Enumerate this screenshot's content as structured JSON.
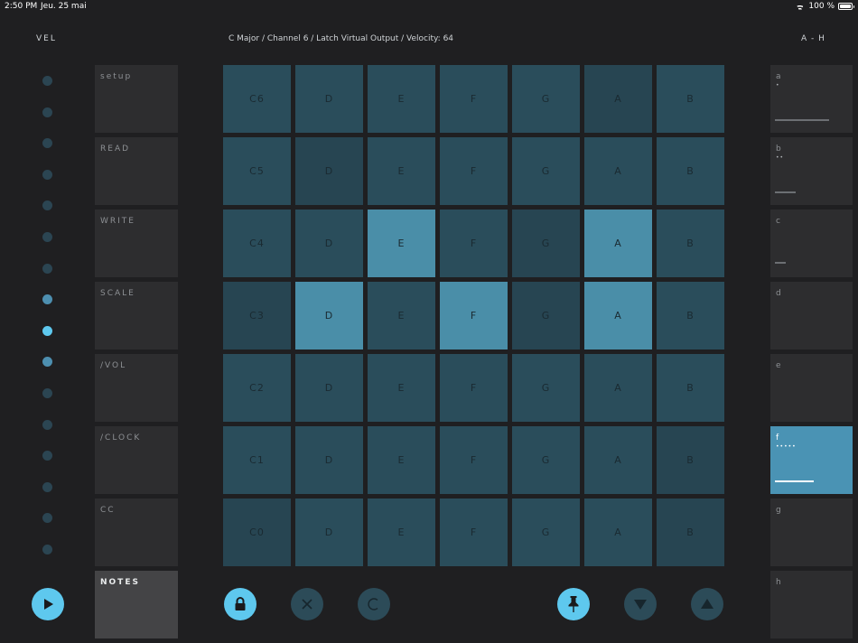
{
  "status": {
    "time": "2:50 PM",
    "date": "Jeu. 25 mai",
    "battery": "100 %"
  },
  "header": {
    "vel_title": "VEL",
    "info": "C Major / Channel 6 / Latch Virtual Output / Velocity: 64",
    "slots_title": "A - H"
  },
  "velocity": {
    "levels": 16,
    "active_level": 8,
    "lit_levels": [
      7,
      8,
      9
    ]
  },
  "menu": [
    {
      "label": "setup",
      "active": false
    },
    {
      "label": "READ",
      "active": false
    },
    {
      "label": "WRITE",
      "active": false
    },
    {
      "label": "SCALE",
      "active": false
    },
    {
      "label": "/VOL",
      "active": false
    },
    {
      "label": "/CLOCK",
      "active": false
    },
    {
      "label": "CC",
      "active": false
    },
    {
      "label": "NOTES",
      "active": true
    }
  ],
  "grid": {
    "rows": [
      {
        "notes": [
          "C6",
          "D",
          "E",
          "F",
          "G",
          "A",
          "B"
        ],
        "lit": [
          false,
          false,
          false,
          false,
          false,
          false,
          false
        ]
      },
      {
        "notes": [
          "C5",
          "D",
          "E",
          "F",
          "G",
          "A",
          "B"
        ],
        "lit": [
          false,
          false,
          false,
          false,
          false,
          false,
          false
        ]
      },
      {
        "notes": [
          "C4",
          "D",
          "E",
          "F",
          "G",
          "A",
          "B"
        ],
        "lit": [
          false,
          false,
          true,
          false,
          false,
          true,
          false
        ]
      },
      {
        "notes": [
          "C3",
          "D",
          "E",
          "F",
          "G",
          "A",
          "B"
        ],
        "lit": [
          false,
          true,
          false,
          true,
          false,
          true,
          false
        ]
      },
      {
        "notes": [
          "C2",
          "D",
          "E",
          "F",
          "G",
          "A",
          "B"
        ],
        "lit": [
          false,
          false,
          false,
          false,
          false,
          false,
          false
        ]
      },
      {
        "notes": [
          "C1",
          "D",
          "E",
          "F",
          "G",
          "A",
          "B"
        ],
        "lit": [
          false,
          false,
          false,
          false,
          false,
          false,
          false
        ]
      },
      {
        "notes": [
          "C0",
          "D",
          "E",
          "F",
          "G",
          "A",
          "B"
        ],
        "lit": [
          false,
          false,
          false,
          false,
          false,
          false,
          false
        ]
      }
    ]
  },
  "slots": [
    {
      "label": "a",
      "dots": "•",
      "level": 0.85,
      "selected": false
    },
    {
      "label": "b",
      "dots": "••",
      "level": 0.33,
      "selected": false
    },
    {
      "label": "c",
      "dots": "",
      "level": 0.17,
      "selected": false
    },
    {
      "label": "d",
      "dots": "",
      "level": 0,
      "selected": false
    },
    {
      "label": "e",
      "dots": "",
      "level": 0,
      "selected": false
    },
    {
      "label": "f",
      "dots": "•••••",
      "level": 0.6,
      "selected": true
    },
    {
      "label": "g",
      "dots": "",
      "level": 0,
      "selected": false
    },
    {
      "label": "h",
      "dots": "",
      "level": 0,
      "selected": false
    }
  ],
  "bottom_buttons": {
    "play": {
      "icon": "play-icon",
      "on": true
    },
    "lock": {
      "icon": "lock-icon",
      "on": true
    },
    "clear": {
      "icon": "close-icon",
      "on": false
    },
    "cycle": {
      "icon": "c-icon",
      "on": false
    },
    "pin": {
      "icon": "pin-icon",
      "on": true
    },
    "down": {
      "icon": "triangle-down-icon",
      "on": false
    },
    "up": {
      "icon": "triangle-up-icon",
      "on": false
    }
  },
  "colors": {
    "background": "#1f1f21",
    "pad": "#2a4d5b",
    "pad_lit": "#4a8ea8",
    "accent": "#5ec8ee",
    "slot_selected": "#4a93b4"
  }
}
